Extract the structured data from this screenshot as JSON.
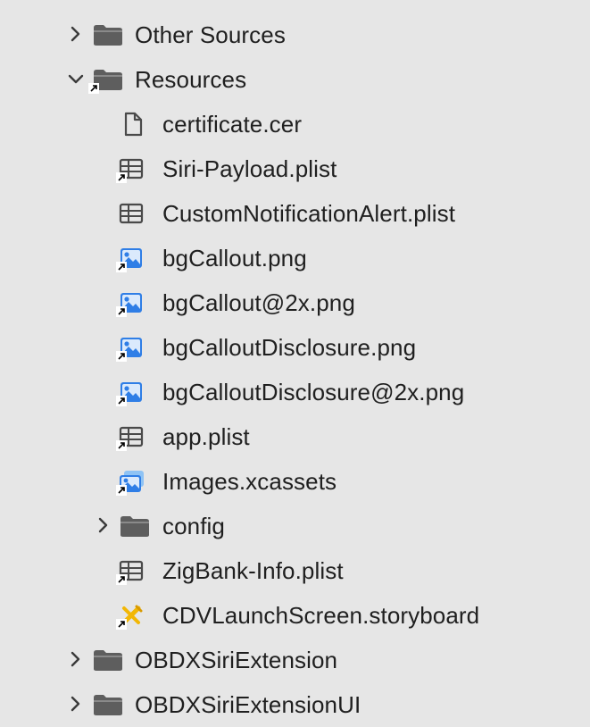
{
  "navigator": {
    "items": [
      {
        "label": "Other Sources",
        "kind": "folder",
        "state": "collapsed"
      },
      {
        "label": "Resources",
        "kind": "folder",
        "state": "expanded",
        "alias": true
      },
      {
        "label": "certificate.cer",
        "kind": "file"
      },
      {
        "label": "Siri-Payload.plist",
        "kind": "plist",
        "alias": true
      },
      {
        "label": "CustomNotificationAlert.plist",
        "kind": "plist"
      },
      {
        "label": "bgCallout.png",
        "kind": "image",
        "alias": true
      },
      {
        "label": "bgCallout@2x.png",
        "kind": "image",
        "alias": true
      },
      {
        "label": "bgCalloutDisclosure.png",
        "kind": "image",
        "alias": true
      },
      {
        "label": "bgCalloutDisclosure@2x.png",
        "kind": "image",
        "alias": true
      },
      {
        "label": "app.plist",
        "kind": "plist",
        "alias": true
      },
      {
        "label": "Images.xcassets",
        "kind": "xcassets",
        "alias": true
      },
      {
        "label": "config",
        "kind": "folder",
        "state": "collapsed"
      },
      {
        "label": "ZigBank-Info.plist",
        "kind": "plist",
        "alias": true
      },
      {
        "label": "CDVLaunchScreen.storyboard",
        "kind": "storyboard",
        "alias": true
      },
      {
        "label": "OBDXSiriExtension",
        "kind": "folder",
        "state": "collapsed"
      },
      {
        "label": "OBDXSiriExtensionUI",
        "kind": "folder",
        "state": "collapsed"
      }
    ]
  },
  "colors": {
    "background": "#e6e6e6",
    "text": "#1f1f1f",
    "folder": "#5e5e5e",
    "image_blue": "#2f7ee6",
    "storyboard_yellow": "#f2b705"
  }
}
